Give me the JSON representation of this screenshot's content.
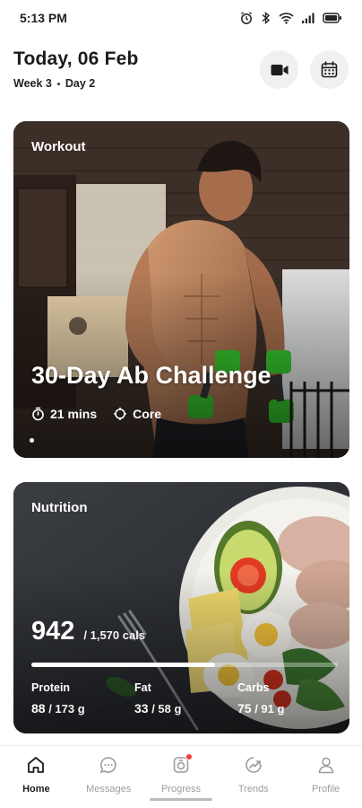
{
  "status_bar": {
    "time": "5:13 PM"
  },
  "header": {
    "date": "Today, 06 Feb",
    "week": "Week 3",
    "day": "Day 2",
    "icons": [
      "video-camera-icon",
      "calendar-icon"
    ]
  },
  "workout": {
    "label": "Workout",
    "title": "30-Day Ab Challenge",
    "duration": "21 mins",
    "focus": "Core",
    "pages": 1,
    "active_page": 0
  },
  "nutrition": {
    "label": "Nutrition",
    "calories": "942",
    "calories_total": "/ 1,570 cals",
    "progress": 0.6,
    "macros": [
      {
        "name": "Protein",
        "value": "88",
        "total": "/ 173 g"
      },
      {
        "name": "Fat",
        "value": "33",
        "total": "/ 58 g"
      },
      {
        "name": "Carbs",
        "value": "75",
        "total": "/ 91 g"
      }
    ]
  },
  "nav": {
    "items": [
      {
        "label": "Home",
        "icon": "home-icon",
        "active": true
      },
      {
        "label": "Messages",
        "icon": "chat-icon",
        "active": false
      },
      {
        "label": "Progress",
        "icon": "progress-icon",
        "active": false,
        "badge": true
      },
      {
        "label": "Trends",
        "icon": "trends-icon",
        "active": false
      },
      {
        "label": "Profile",
        "icon": "profile-icon",
        "active": false
      }
    ]
  },
  "colors": {
    "accent_green": "#35c42c",
    "badge_red": "#ef3b3b",
    "active_nav": "#1c1c1e",
    "inactive_nav": "#9a9ca0"
  }
}
